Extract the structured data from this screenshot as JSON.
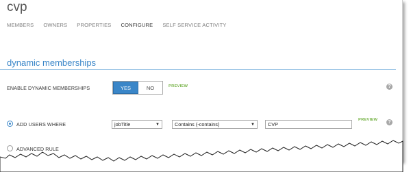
{
  "app": {
    "title": "cvp"
  },
  "tabs": [
    {
      "label": "MEMBERS",
      "active": false
    },
    {
      "label": "OWNERS",
      "active": false
    },
    {
      "label": "PROPERTIES",
      "active": false
    },
    {
      "label": "CONFIGURE",
      "active": true
    },
    {
      "label": "SELF SERVICE ACTIVITY",
      "active": false
    }
  ],
  "section": {
    "title": "dynamic memberships"
  },
  "enable_dynamic": {
    "label": "ENABLE DYNAMIC MEMBERSHIPS",
    "yes_label": "YES",
    "no_label": "NO",
    "selected": "YES",
    "preview_label": "PREVIEW",
    "help_icon": "?"
  },
  "add_users": {
    "label": "ADD USERS WHERE",
    "selected": true,
    "attribute_value": "jobTitle",
    "operator_value": "Contains (-contains)",
    "value": "CVP",
    "preview_label": "PREVIEW",
    "help_icon": "?"
  },
  "advanced_rule": {
    "label": "ADVANCED RULE",
    "selected": false,
    "help_icon": "?"
  },
  "colors": {
    "accent": "#3a86c8",
    "preview": "#77b347",
    "help": "#a8a8a8"
  }
}
